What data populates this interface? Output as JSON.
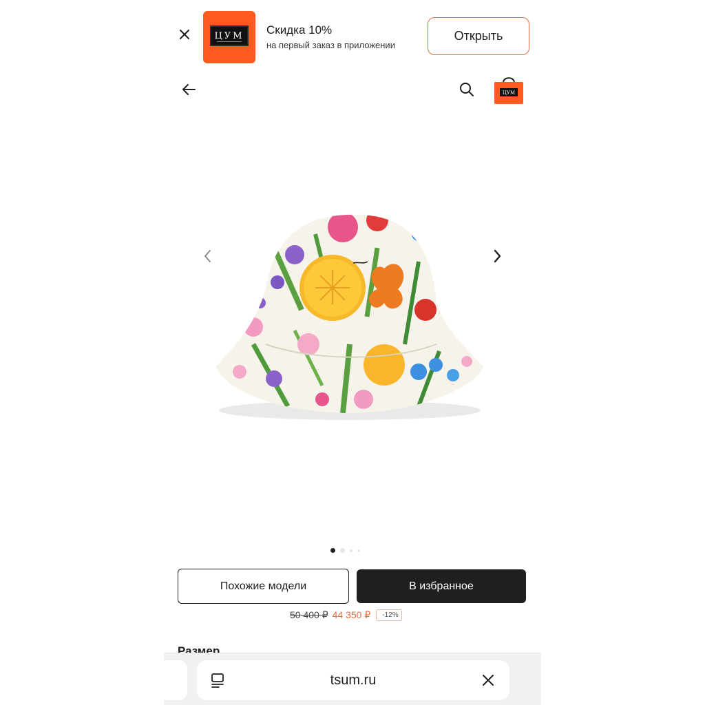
{
  "banner": {
    "logo_text": "ЦУМ",
    "title": "Скидка 10%",
    "subtitle": "на первый заказ в приложении",
    "open_label": "Открыть",
    "accent_color": "#ff5a1f"
  },
  "nav": {
    "back_icon": "arrow-left-icon",
    "search_icon": "search-icon",
    "bag_icon": "shopping-bag-icon",
    "bag_logo_text": "ЦУМ"
  },
  "gallery": {
    "image": "floral-bucket-hat",
    "total_images": 4,
    "active_index": 0
  },
  "actions": {
    "similar_label": "Похожие модели",
    "favorite_label": "В избранное"
  },
  "price": {
    "old": "50 400 ₽",
    "new": "44 350 ₽",
    "discount": "-12%",
    "new_color": "#e86a3b"
  },
  "size_label": "Размер",
  "browser": {
    "url": "tsum.ru"
  }
}
